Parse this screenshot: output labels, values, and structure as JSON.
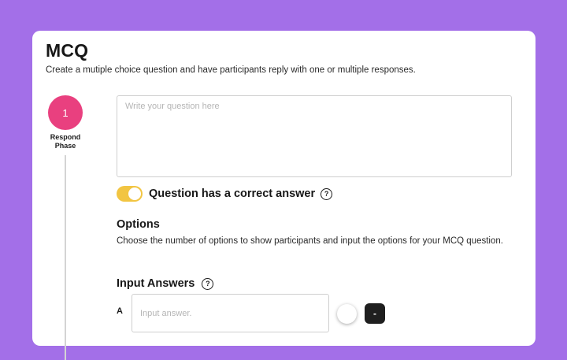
{
  "header": {
    "title": "MCQ",
    "subtitle": "Create a mutiple choice question and have participants reply with one or multiple responses."
  },
  "phase": {
    "number": "1",
    "label": "Respond Phase",
    "color": "#e9407f"
  },
  "question": {
    "value": "",
    "placeholder": "Write your question here"
  },
  "correct_answer": {
    "label": "Question has a correct answer",
    "enabled": true,
    "toggle_color": "#f2c542",
    "help_icon": "question-circle-icon",
    "help_glyph": "?"
  },
  "options": {
    "title": "Options",
    "description": "Choose the number of options to show participants and input the options for your MCQ question."
  },
  "answers": {
    "title": "Input Answers",
    "help_icon": "question-circle-icon",
    "help_glyph": "?",
    "items": [
      {
        "letter": "A",
        "value": "",
        "placeholder": "Input answer.",
        "remove_label": "-"
      }
    ]
  },
  "colors": {
    "background": "#a36fe8",
    "card": "#ffffff"
  }
}
